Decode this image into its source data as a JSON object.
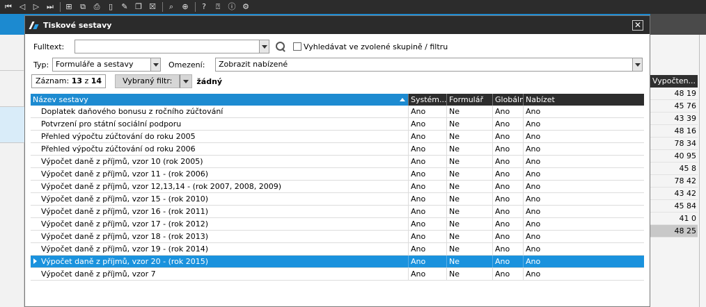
{
  "dialog": {
    "title": "Tiskové sestavy",
    "fulltext_label": "Fulltext:",
    "fulltext_value": "",
    "search_in_group_label": "Vyhledávat ve zvolené skupině / filtru",
    "typ_label": "Typ:",
    "typ_value": "Formuláře a sestavy",
    "omezeni_label": "Omezení:",
    "omezeni_value": "Zobrazit nabízené",
    "zaznam_label": "Záznam:",
    "zaznam_current": "13",
    "zaznam_of": "z",
    "zaznam_total": "14",
    "filter_button_label": "Vybraný filtr:",
    "filter_value": "žádný"
  },
  "table": {
    "columns": [
      "Název sestavy",
      "Systém...",
      "Formulář",
      "Globální",
      "Nabízet"
    ],
    "selected_index": 12,
    "rows": [
      [
        "Doplatek daňového bonusu z ročního zúčtování",
        "Ano",
        "Ne",
        "Ano",
        "Ano"
      ],
      [
        "Potvrzení pro státní sociální podporu",
        "Ano",
        "Ne",
        "Ano",
        "Ano"
      ],
      [
        "Přehled výpočtu zúčtování do roku 2005",
        "Ano",
        "Ne",
        "Ano",
        "Ano"
      ],
      [
        "Přehled výpočtu zúčtování od roku 2006",
        "Ano",
        "Ne",
        "Ano",
        "Ano"
      ],
      [
        "Výpočet daně z příjmů, vzor 10  (rok 2005)",
        "Ano",
        "Ne",
        "Ano",
        "Ano"
      ],
      [
        "Výpočet daně z příjmů, vzor 11 - (rok 2006)",
        "Ano",
        "Ne",
        "Ano",
        "Ano"
      ],
      [
        "Výpočet daně z příjmů, vzor 12,13,14 - (rok 2007, 2008, 2009)",
        "Ano",
        "Ne",
        "Ano",
        "Ano"
      ],
      [
        "Výpočet daně z příjmů, vzor 15 - (rok 2010)",
        "Ano",
        "Ne",
        "Ano",
        "Ano"
      ],
      [
        "Výpočet daně z příjmů, vzor 16 - (rok 2011)",
        "Ano",
        "Ne",
        "Ano",
        "Ano"
      ],
      [
        "Výpočet daně z příjmů, vzor 17 - (rok 2012)",
        "Ano",
        "Ne",
        "Ano",
        "Ano"
      ],
      [
        "Výpočet daně z příjmů, vzor 18 - (rok 2013)",
        "Ano",
        "Ne",
        "Ano",
        "Ano"
      ],
      [
        "Výpočet daně z příjmů, vzor 19 - (rok 2014)",
        "Ano",
        "Ne",
        "Ano",
        "Ano"
      ],
      [
        "Výpočet daně z příjmů, vzor 20 - (rok 2015)",
        "Ano",
        "Ne",
        "Ano",
        "Ano"
      ],
      [
        "Výpočet daně z příjmů, vzor 7",
        "Ano",
        "Ne",
        "Ano",
        "Ano"
      ]
    ]
  },
  "background": {
    "grid_header": "Vypočten...",
    "grid_values": [
      "48 19",
      "45 76",
      "43 39",
      "48 16",
      "78 34",
      "40 95",
      "45 8",
      "78 42",
      "43 42",
      "45 84",
      "41 0",
      "48 25"
    ]
  },
  "toolbar_icons": [
    "first-record-icon",
    "prev-record-icon",
    "next-record-icon",
    "last-record-icon",
    "new-record-icon",
    "copy-record-icon",
    "print-icon",
    "blank-document-icon",
    "edit-icon",
    "copy-icon",
    "delete-icon",
    "find-icon",
    "find-next-icon",
    "help-icon",
    "help-context-icon",
    "about-icon",
    "options-icon"
  ]
}
